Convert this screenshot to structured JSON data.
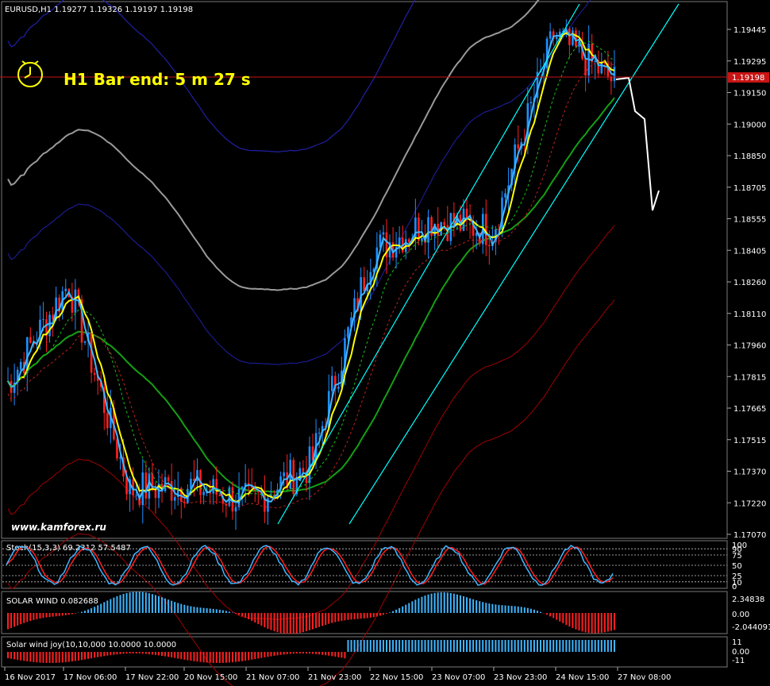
{
  "header": {
    "symbol_info": "EURUSD,H1  1.19277 1.19326 1.19197 1.19198",
    "bar_end": "H1 Bar end: 5 m 27 s",
    "watermark": "www.kamforex.ru",
    "current_price": "1.19198"
  },
  "colors": {
    "background": "#000000",
    "bull": "#1e90ff",
    "bear": "#ff2020",
    "yellow_line": "#ffff00",
    "cyan_line": "#00ffff",
    "green_line": "#14a014",
    "price_line": "#c81414",
    "forecast": "#ffffff"
  },
  "price_axis": {
    "labels": [
      "1.19445",
      "1.19295",
      "1.19150",
      "1.19000",
      "1.18850",
      "1.18705",
      "1.18555",
      "1.18405",
      "1.18260",
      "1.18110",
      "1.17960",
      "1.17815",
      "1.17665",
      "1.17515",
      "1.17370",
      "1.17220",
      "1.17070"
    ]
  },
  "time_axis": {
    "labels": [
      "16 Nov 2017",
      "17 Nov 06:00",
      "17 Nov 22:00",
      "20 Nov 15:00",
      "21 Nov 07:00",
      "21 Nov 23:00",
      "22 Nov 15:00",
      "23 Nov 07:00",
      "23 Nov 23:00",
      "24 Nov 15:00",
      "27 Nov 08:00"
    ]
  },
  "stoch": {
    "title": "Stoch(15,3,3) 69.2312 57.5487",
    "levels": [
      "100",
      "75",
      "50",
      "25",
      "0"
    ],
    "extra_level": "90",
    "extra_level2": "10"
  },
  "solar_wind": {
    "title": "SOLAR WIND 0.082688",
    "levels": [
      "2.34838",
      "0.00",
      "-2.044091"
    ]
  },
  "solar_wind_joy": {
    "title": "Solar wind joy(10,10,000 10.0000 10.0000",
    "levels": [
      "11",
      "0.00",
      "-11"
    ]
  },
  "chart_data": {
    "type": "candlestick",
    "symbol": "EURUSD",
    "timeframe": "H1",
    "ylim": [
      1.17,
      1.196
    ],
    "last_price": 1.19198,
    "open_high_low_close": [
      1.19277,
      1.19326,
      1.19197,
      1.19198
    ],
    "approx_path": [
      {
        "t": "16 Nov 2017",
        "price": 1.1778
      },
      {
        "t": "17 Nov 06:00",
        "price": 1.1825
      },
      {
        "t": "17 Nov 22:00",
        "price": 1.1728
      },
      {
        "t": "20 Nov 15:00",
        "price": 1.173
      },
      {
        "t": "21 Nov 07:00",
        "price": 1.1722
      },
      {
        "t": "21 Nov 23:00",
        "price": 1.174
      },
      {
        "t": "22 Nov 15:00",
        "price": 1.184
      },
      {
        "t": "23 Nov 07:00",
        "price": 1.1855
      },
      {
        "t": "23 Nov 23:00",
        "price": 1.185
      },
      {
        "t": "24 Nov 15:00",
        "price": 1.1942
      },
      {
        "t": "27 Nov 08:00",
        "price": 1.192
      }
    ]
  }
}
